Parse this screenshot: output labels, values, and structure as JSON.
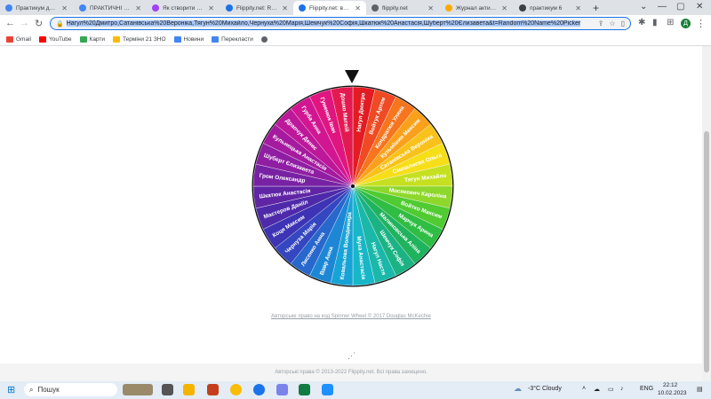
{
  "tabs": [
    {
      "label": "Практикум для с",
      "color": "#4285f4"
    },
    {
      "label": "ПРАКТИЧНІ РОБО",
      "color": "#4285f4"
    },
    {
      "label": "Як створити рано",
      "color": "#a142f4"
    },
    {
      "label": "Flippity.net: Rand",
      "color": "#1a73e8"
    },
    {
      "label": "Flippity.net: вибо",
      "color": "#1a73e8"
    },
    {
      "label": "flippity.net",
      "color": "#5f6368"
    },
    {
      "label": "Журнал активно",
      "color": "#f9ab00"
    },
    {
      "label": "практикум 6",
      "color": "#3c4043"
    }
  ],
  "toolbar": {
    "url": "Нагул%20Дмитро,Сатанівська%20Вероніка,Тягун%20Михайло,Чернуха%20Марія,Шемчук%20Софія,Шкатюк%20Анастасія,Шуберт%20Єлизавета&t=Random%20Name%20Picker",
    "avatar": "Д"
  },
  "bookmarks": [
    {
      "label": "Gmail",
      "color": "#ea4335"
    },
    {
      "label": "YouTube",
      "color": "#ff0000"
    },
    {
      "label": "Карти",
      "color": "#34a853"
    },
    {
      "label": "Терміни 21 ЗНО",
      "color": "#fbbc04"
    },
    {
      "label": "Новини",
      "color": "#4285f4"
    },
    {
      "label": "Перекласти",
      "color": "#4285f4"
    },
    {
      "label": "",
      "color": "#5f6368"
    }
  ],
  "wheel": {
    "names": [
      "Нагул Дмитро",
      "Войтук Артем",
      "Кондратюк Уляна",
      "Кузьмішин Максим",
      "Сатанівська Вероніка",
      "Смишляєва Ольга",
      "Тягун Михайло",
      "Мосякевич Кароліна",
      "Войтко Максим",
      "Марчук Арина",
      "Малиновська Аліна",
      "Шемчук Софія",
      "Нагул Настя",
      "Муха Анастасія",
      "Ковальова Володимира",
      "Вавр Анна",
      "Лисенко Анна",
      "Чернуха Марія",
      "Коця Максим",
      "Мастеров Даніїл",
      "Шкатюк Анастасія",
      "Гром Олександр",
      "Шуберт Єлизавета",
      "Кульнецька Анастасія",
      "Драпчук Денис",
      "Гурба Анна",
      "Гуменюк Іван",
      "Дошко Матвій"
    ],
    "colors": [
      "#e31b23",
      "#ef4a23",
      "#f7751d",
      "#f9a11b",
      "#f8c21a",
      "#f6de19",
      "#c6e021",
      "#8ed72b",
      "#50cb32",
      "#2fbd43",
      "#20b35e",
      "#1bb383",
      "#1ab8a8",
      "#17b7c8",
      "#18a3d6",
      "#1d87d5",
      "#2867cc",
      "#3447c0",
      "#3d33b4",
      "#4e2aaa",
      "#6025a5",
      "#7822a3",
      "#8f1ea3",
      "#a61a9f",
      "#bd179a",
      "#d21692",
      "#e01580",
      "#e31a50"
    ]
  },
  "credit": {
    "prefix": "Авторське право на код ",
    "link": "Spinner Wheel © 2017 Douglas McKechie"
  },
  "footer": "Авторські права © 2013-2022 Flippity.net. Всі права захищено.",
  "taskbar": {
    "search_label": "Пошук",
    "weather": "-3°C  Cloudy",
    "lang": "ENG",
    "time": "22:12",
    "date": "10.02.2023"
  }
}
